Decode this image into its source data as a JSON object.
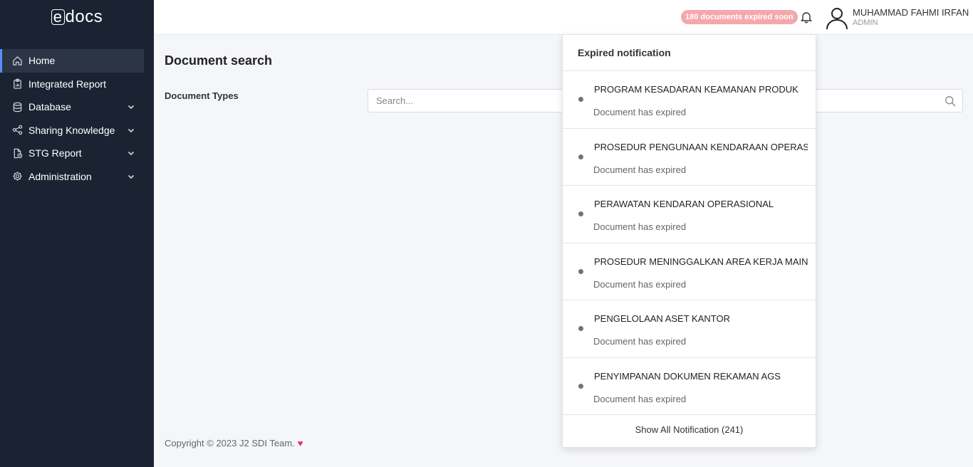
{
  "app": {
    "logo_e": "e",
    "logo_rest": "docs"
  },
  "sidebar": {
    "items": [
      {
        "label": "Home",
        "icon": "home-icon",
        "active": true,
        "has_submenu": false
      },
      {
        "label": "Integrated Report",
        "icon": "clipboard-icon",
        "active": false,
        "has_submenu": false
      },
      {
        "label": "Database",
        "icon": "database-icon",
        "active": false,
        "has_submenu": true
      },
      {
        "label": "Sharing Knowledge",
        "icon": "share-icon",
        "active": false,
        "has_submenu": true
      },
      {
        "label": "STG Report",
        "icon": "file-clock-icon",
        "active": false,
        "has_submenu": true
      },
      {
        "label": "Administration",
        "icon": "gear-icon",
        "active": false,
        "has_submenu": true
      }
    ]
  },
  "header": {
    "expiry_badge": "180 documents expired soon",
    "user_name": "MUHAMMAD FAHMI IRFAN",
    "user_role": "ADMIN"
  },
  "main": {
    "title": "Document search",
    "field_label": "Document Types",
    "search_placeholder": "Search..."
  },
  "footer": {
    "copyright": "Copyright © 2023 J2 SDI Team.",
    "heart": "♥"
  },
  "notifications": {
    "title": "Expired notification",
    "items": [
      {
        "title": "PROGRAM KESADARAN KEAMANAN PRODUK",
        "status": "Document has expired"
      },
      {
        "title": "PROSEDUR PENGUNAAN KENDARAAN OPERASIONAL",
        "status": "Document has expired"
      },
      {
        "title": "PERAWATAN KENDARAN OPERASIONAL",
        "status": "Document has expired"
      },
      {
        "title": "PROSEDUR MENINGGALKAN AREA KERJA MAIN OFFICE",
        "status": "Document has expired"
      },
      {
        "title": "PENGELOLAAN ASET KANTOR",
        "status": "Document has expired"
      },
      {
        "title": "PENYIMPANAN DOKUMEN REKAMAN AGS",
        "status": "Document has expired"
      }
    ],
    "show_all": "Show All Notification (241)"
  },
  "colors": {
    "sidebar_bg": "#1b2333",
    "badge": "#f4a8ab",
    "heart": "#e0306f",
    "active_accent": "#5b8cff"
  }
}
